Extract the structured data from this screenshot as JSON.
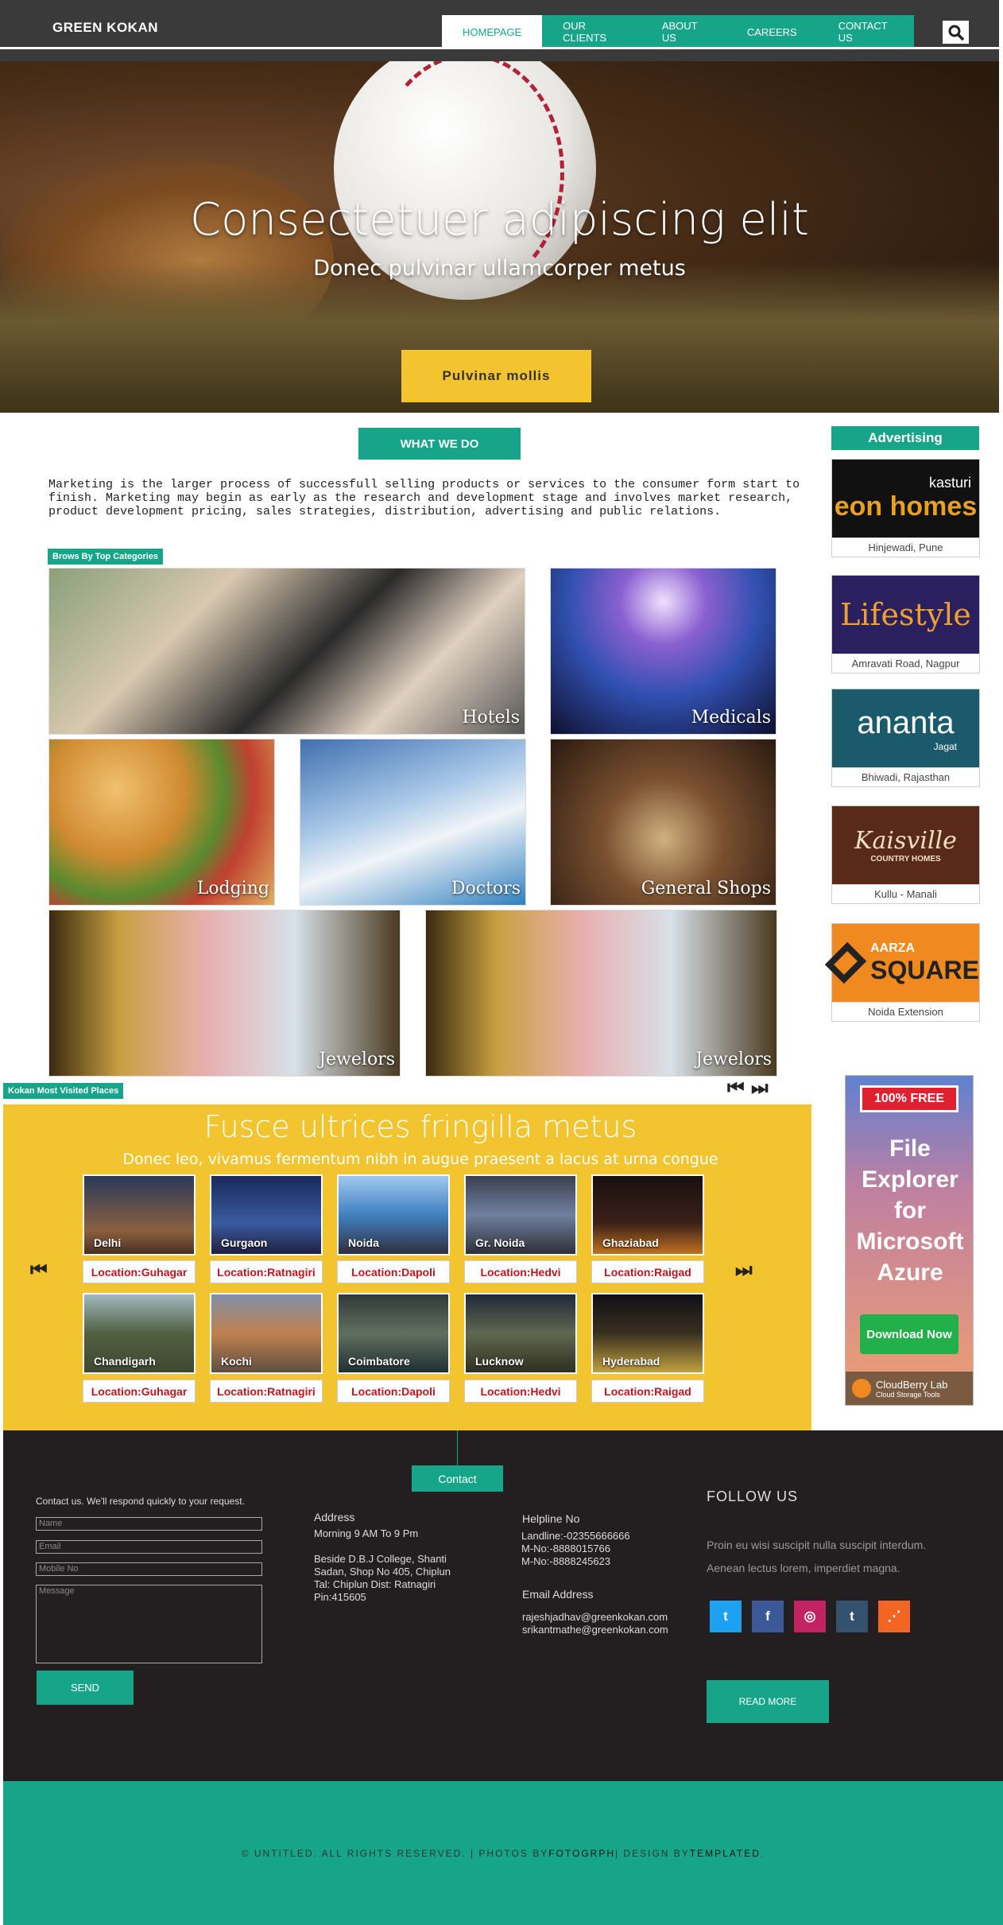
{
  "header": {
    "logo": "GREEN KOKAN",
    "nav": [
      "HOMEPAGE",
      "OUR CLIENTS",
      "ABOUT US",
      "CAREERS",
      "CONTACT US"
    ]
  },
  "hero": {
    "title": "Consectetuer adipiscing elit",
    "subtitle": "Donec pulvinar ullamcorper metus",
    "button": "Pulvinar mollis"
  },
  "what_we_do": {
    "heading": "WHAT WE DO",
    "text": "Marketing is the larger process of successfull selling products or services to the consumer form start to finish. Marketing may begin as early as the research and development stage and involves market research, product development pricing, sales strategies, distribution, advertising and public relations."
  },
  "categories": {
    "tag": "Brows By Top Categories",
    "tiles": [
      "Hotels",
      "Medicals",
      "Lodging",
      "Doctors",
      "General Shops",
      "Jewelors",
      "Jewelors"
    ]
  },
  "advertising": {
    "heading": "Advertising",
    "ads": [
      {
        "brand": "kasturi",
        "name": "eon homes",
        "caption": "Hinjewadi, Pune"
      },
      {
        "name": "Lifestyle",
        "caption": "Amravati Road, Nagpur"
      },
      {
        "name": "ananta",
        "sub": "Jagat",
        "caption": "Bhiwadi, Rajasthan"
      },
      {
        "name": "Kaisville",
        "sub": "COUNTRY HOMES",
        "caption": "Kullu - Manali"
      },
      {
        "name": "AARZA",
        "sub": "SQUARE",
        "caption": "Noida Extension"
      }
    ],
    "banner": {
      "badge": "100% FREE",
      "title": "File Explorer for Microsoft Azure",
      "button": "Download Now",
      "brand": "CloudBerry Lab",
      "brand_sub": "Cloud Storage Tools"
    }
  },
  "places": {
    "tag": "Kokan Most Visited Places",
    "title": "Fusce ultrices fringilla metus",
    "subtitle": "Donec leo, vivamus fermentum nibh in augue praesent a lacus at urna congue",
    "row1": [
      {
        "name": "Delhi",
        "loc": "Location:Guhagar"
      },
      {
        "name": "Gurgaon",
        "loc": "Location:Ratnagiri"
      },
      {
        "name": "Noida",
        "loc": "Location:Dapoli"
      },
      {
        "name": "Gr. Noida",
        "loc": "Location:Hedvi"
      },
      {
        "name": "Ghaziabad",
        "loc": "Location:Raigad"
      }
    ],
    "row2": [
      {
        "name": "Chandigarh",
        "loc": "Location:Guhagar"
      },
      {
        "name": "Kochi",
        "loc": "Location:Ratnagiri"
      },
      {
        "name": "Coimbatore",
        "loc": "Location:Dapoli"
      },
      {
        "name": "Lucknow",
        "loc": "Location:Hedvi"
      },
      {
        "name": "Hyderabad",
        "loc": "Location:Raigad"
      }
    ]
  },
  "footer": {
    "contact_tab": "Contact",
    "form_intro": "Contact us. We'll respond quickly to your request.",
    "placeholders": {
      "name": "Name",
      "email": "Email",
      "mobile": "Mobile No",
      "message": "Message"
    },
    "send": "SEND",
    "address_title": "Address",
    "address_hours": "Morning 9 AM To 9 Pm",
    "address_lines": [
      "Beside D.B.J College, Shanti",
      "Sadan, Shop No 405, Chiplun",
      "Tal: Chiplun Dist: Ratnagiri",
      "Pin:415605"
    ],
    "helpline_title": "Helpline No",
    "helpline_lines": [
      "Landline:-02355666666",
      "M-No:-8888015766",
      "M-No:-8888245623"
    ],
    "email_title": "Email Address",
    "emails": [
      "rajeshjadhav@greenkokan.com",
      "srikantmathe@greenkokan.com"
    ],
    "follow_title": "FOLLOW US",
    "follow_text": [
      "Proin eu wisi suscipit nulla suscipit interdum.",
      "Aenean lectus lorem, imperdiet magna."
    ],
    "read_more": "READ MORE",
    "copyright": "© UNTITLED. ALL RIGHTS RESERVED. | PHOTOS BY ",
    "photos_by": "FOTOGRPH",
    "design_by_label": " | DESIGN BY ",
    "design_by": "TEMPLATED",
    "end": "."
  },
  "colors": {
    "teal": "#17a589",
    "yellow": "#f2c530",
    "dark": "#231f20",
    "header": "#3a3a3a"
  }
}
